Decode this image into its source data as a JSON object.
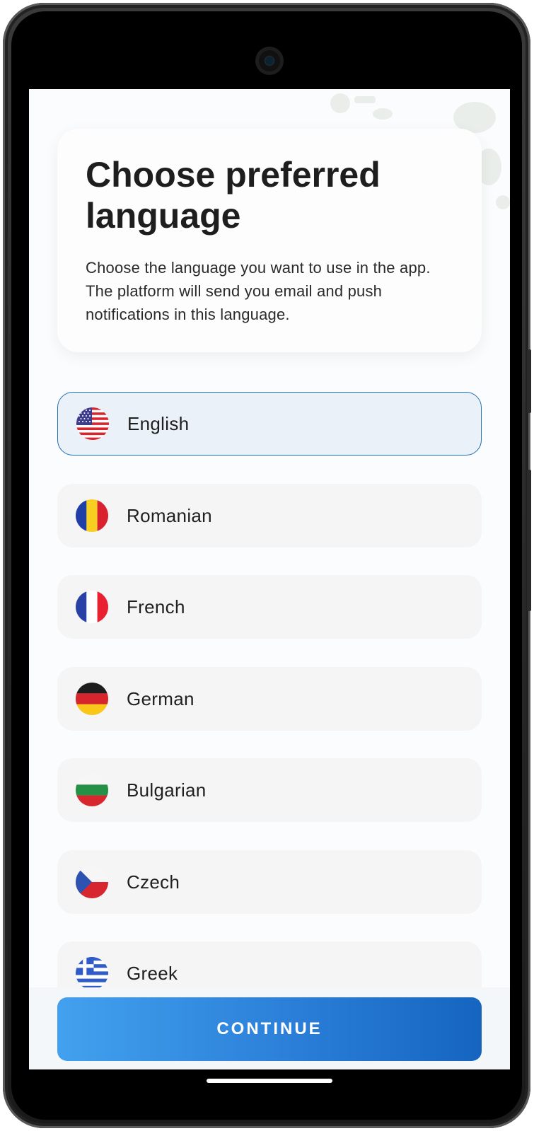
{
  "header": {
    "title": "Choose preferred language",
    "subtitle": "Choose the language you want to use in the app. The platform will send you email and push notifications in this language."
  },
  "languages": [
    {
      "label": "English",
      "flag": "us-flag-icon",
      "selected": true
    },
    {
      "label": "Romanian",
      "flag": "romania-flag-icon",
      "selected": false
    },
    {
      "label": "French",
      "flag": "france-flag-icon",
      "selected": false
    },
    {
      "label": "German",
      "flag": "germany-flag-icon",
      "selected": false
    },
    {
      "label": "Bulgarian",
      "flag": "bulgaria-flag-icon",
      "selected": false
    },
    {
      "label": "Czech",
      "flag": "czech-flag-icon",
      "selected": false
    },
    {
      "label": "Greek",
      "flag": "greece-flag-icon",
      "selected": false
    }
  ],
  "footer": {
    "continue_label": "CONTINUE"
  },
  "colors": {
    "accent": "#1e6fb4",
    "button_gradient_start": "#42a1ee",
    "button_gradient_end": "#1565c0",
    "selected_background": "#ebf1f8",
    "item_background": "#f5f5f5"
  }
}
